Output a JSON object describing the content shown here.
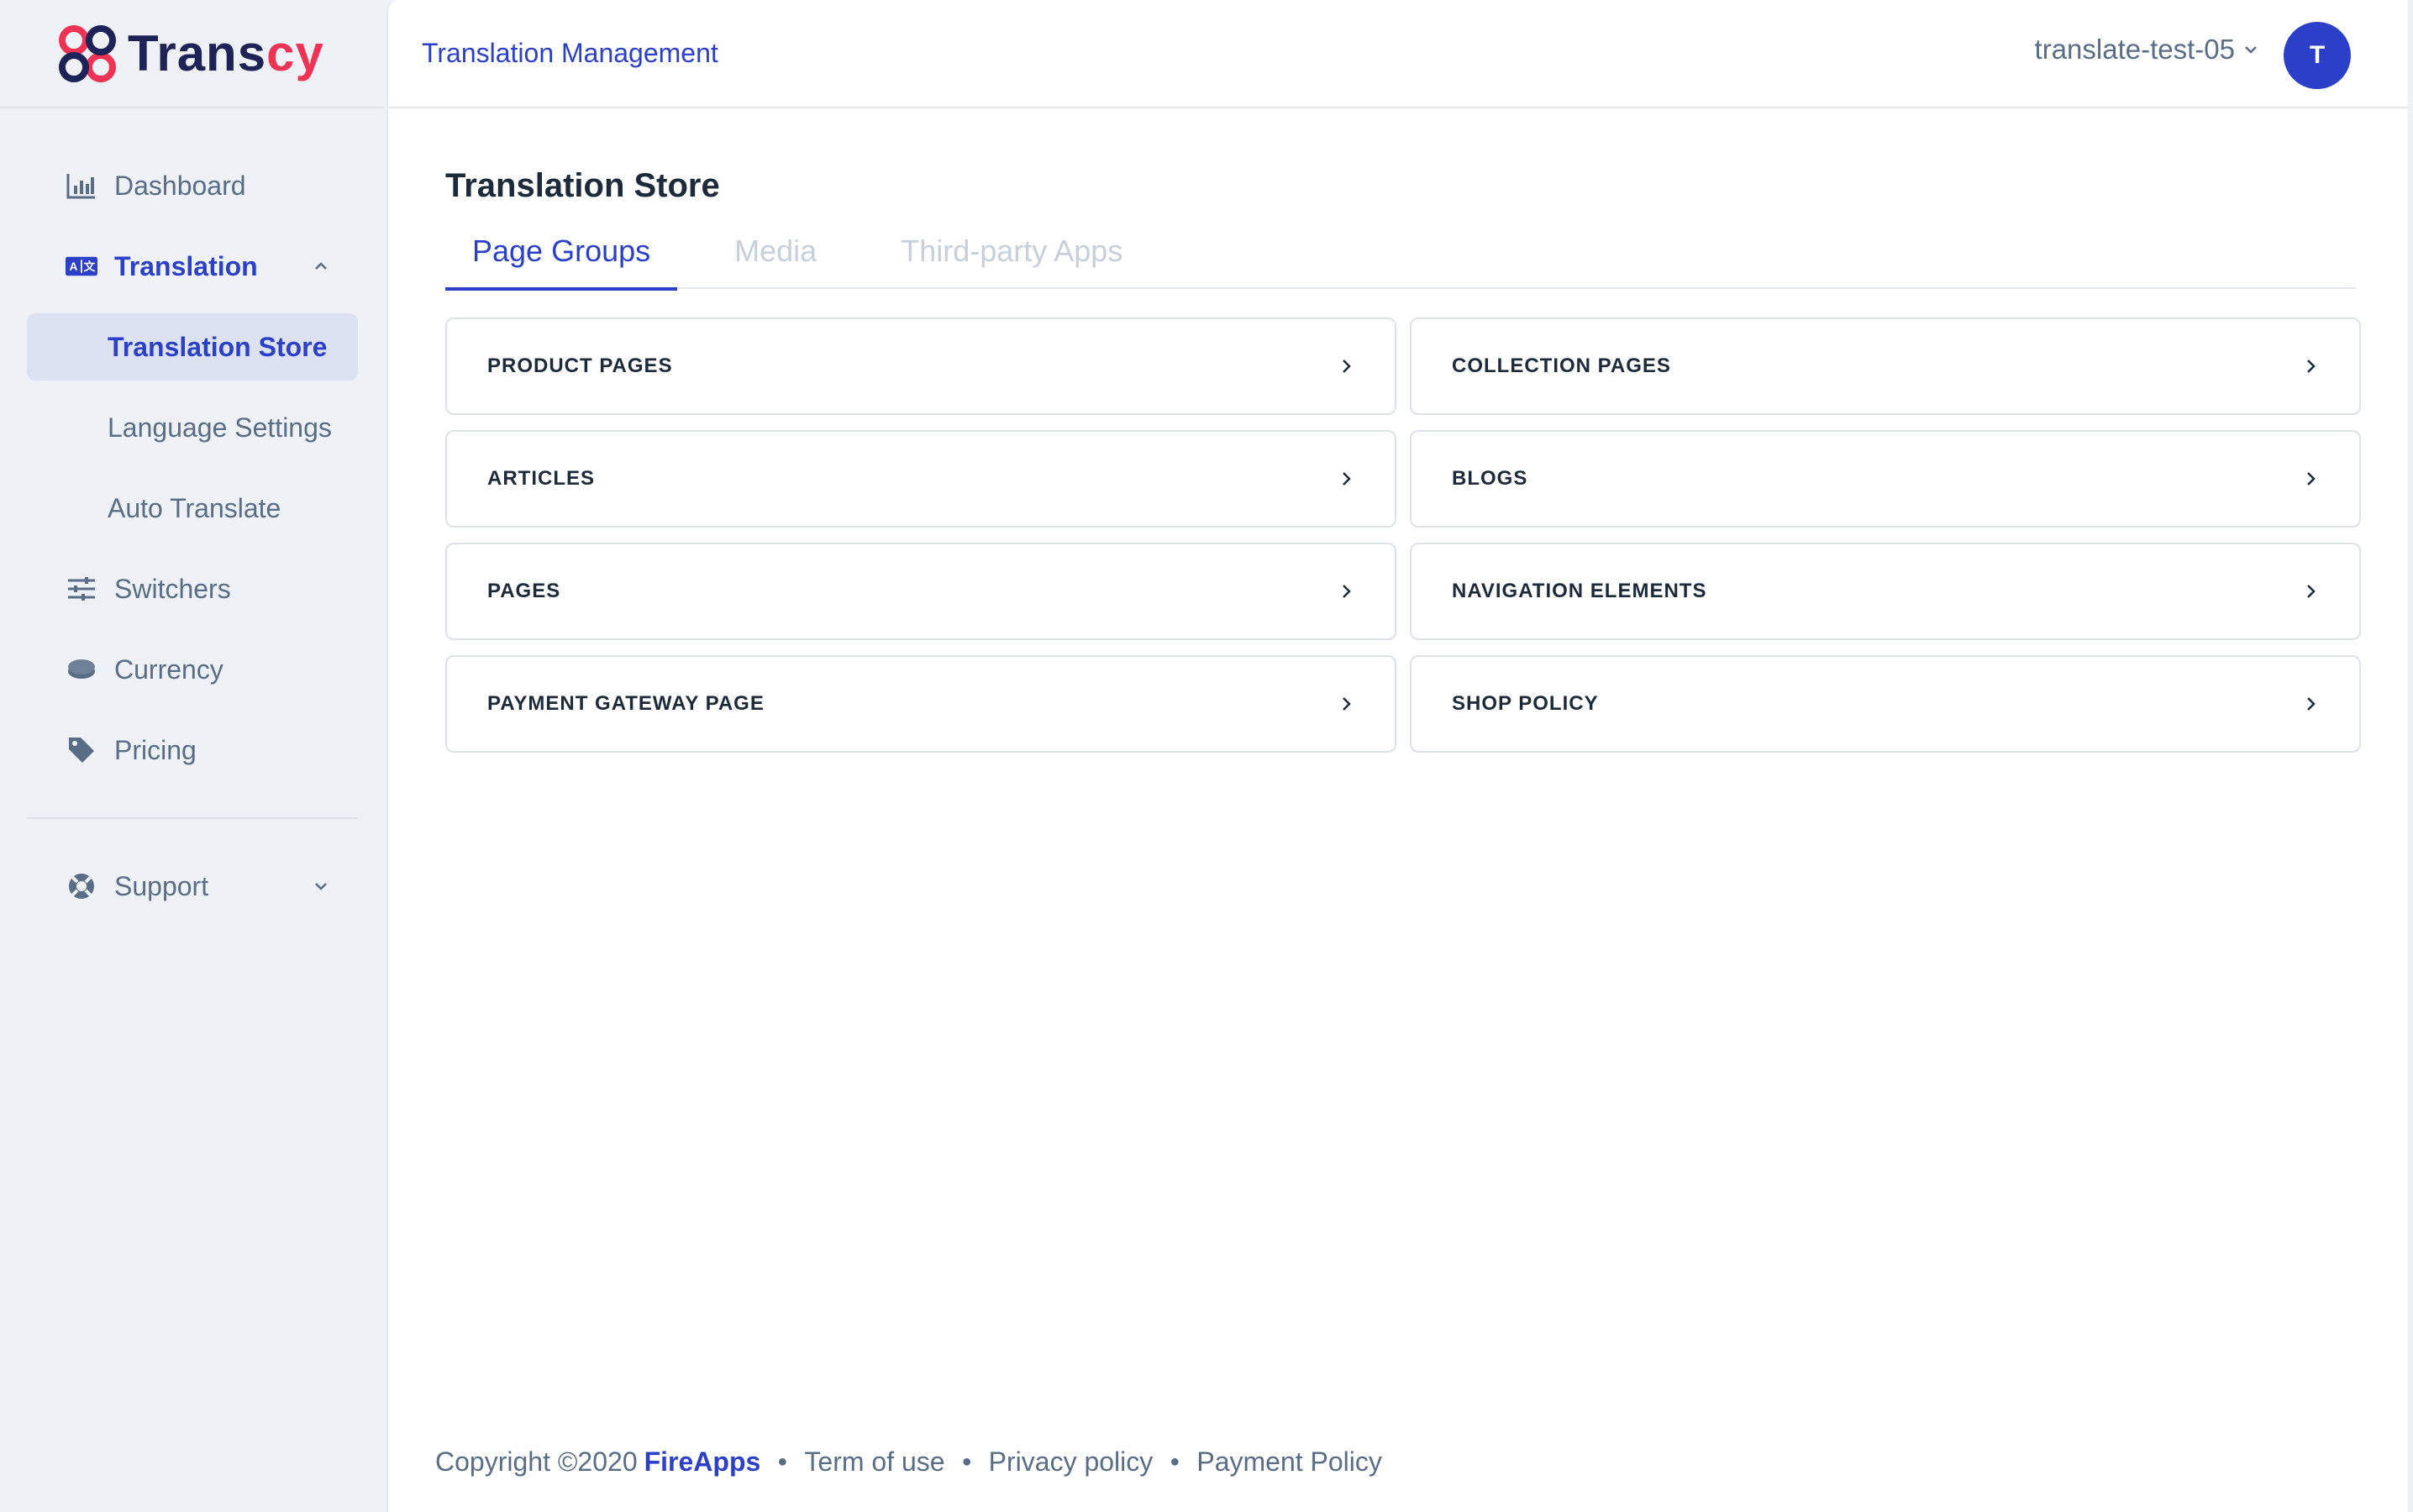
{
  "brand": {
    "name_part1": "Trans",
    "name_part2": "cy",
    "colors": {
      "primary": "#1d2257",
      "accent": "#ef3354"
    }
  },
  "sidebar": {
    "items": [
      {
        "label": "Dashboard",
        "icon": "bar-chart-icon"
      },
      {
        "label": "Translation",
        "icon": "translate-icon",
        "expanded": true,
        "children": [
          {
            "label": "Translation Store",
            "active": true
          },
          {
            "label": "Language Settings"
          },
          {
            "label": "Auto Translate"
          }
        ]
      },
      {
        "label": "Switchers",
        "icon": "sliders-icon"
      },
      {
        "label": "Currency",
        "icon": "coin-icon"
      },
      {
        "label": "Pricing",
        "icon": "tag-icon"
      }
    ],
    "support": {
      "label": "Support",
      "icon": "lifebuoy-icon"
    }
  },
  "header": {
    "title": "Translation Management",
    "store_name": "translate-test-05",
    "avatar_initial": "T"
  },
  "main": {
    "title": "Translation Store",
    "tabs": [
      {
        "label": "Page Groups",
        "active": true
      },
      {
        "label": "Media"
      },
      {
        "label": "Third-party Apps"
      }
    ],
    "cards": [
      "PRODUCT PAGES",
      "COLLECTION PAGES",
      "ARTICLES",
      "BLOGS",
      "PAGES",
      "NAVIGATION ELEMENTS",
      "PAYMENT GATEWAY PAGE",
      "SHOP POLICY"
    ]
  },
  "footer": {
    "copyright": "Copyright ©2020",
    "brand": "FireApps",
    "links": [
      "Term of use",
      "Privacy policy",
      "Payment Policy"
    ]
  },
  "colors": {
    "accent_blue": "#2c3fc8",
    "muted_text": "#5a6d86",
    "sidebar_bg": "#eef1f6",
    "active_bg": "#dde2f3"
  }
}
